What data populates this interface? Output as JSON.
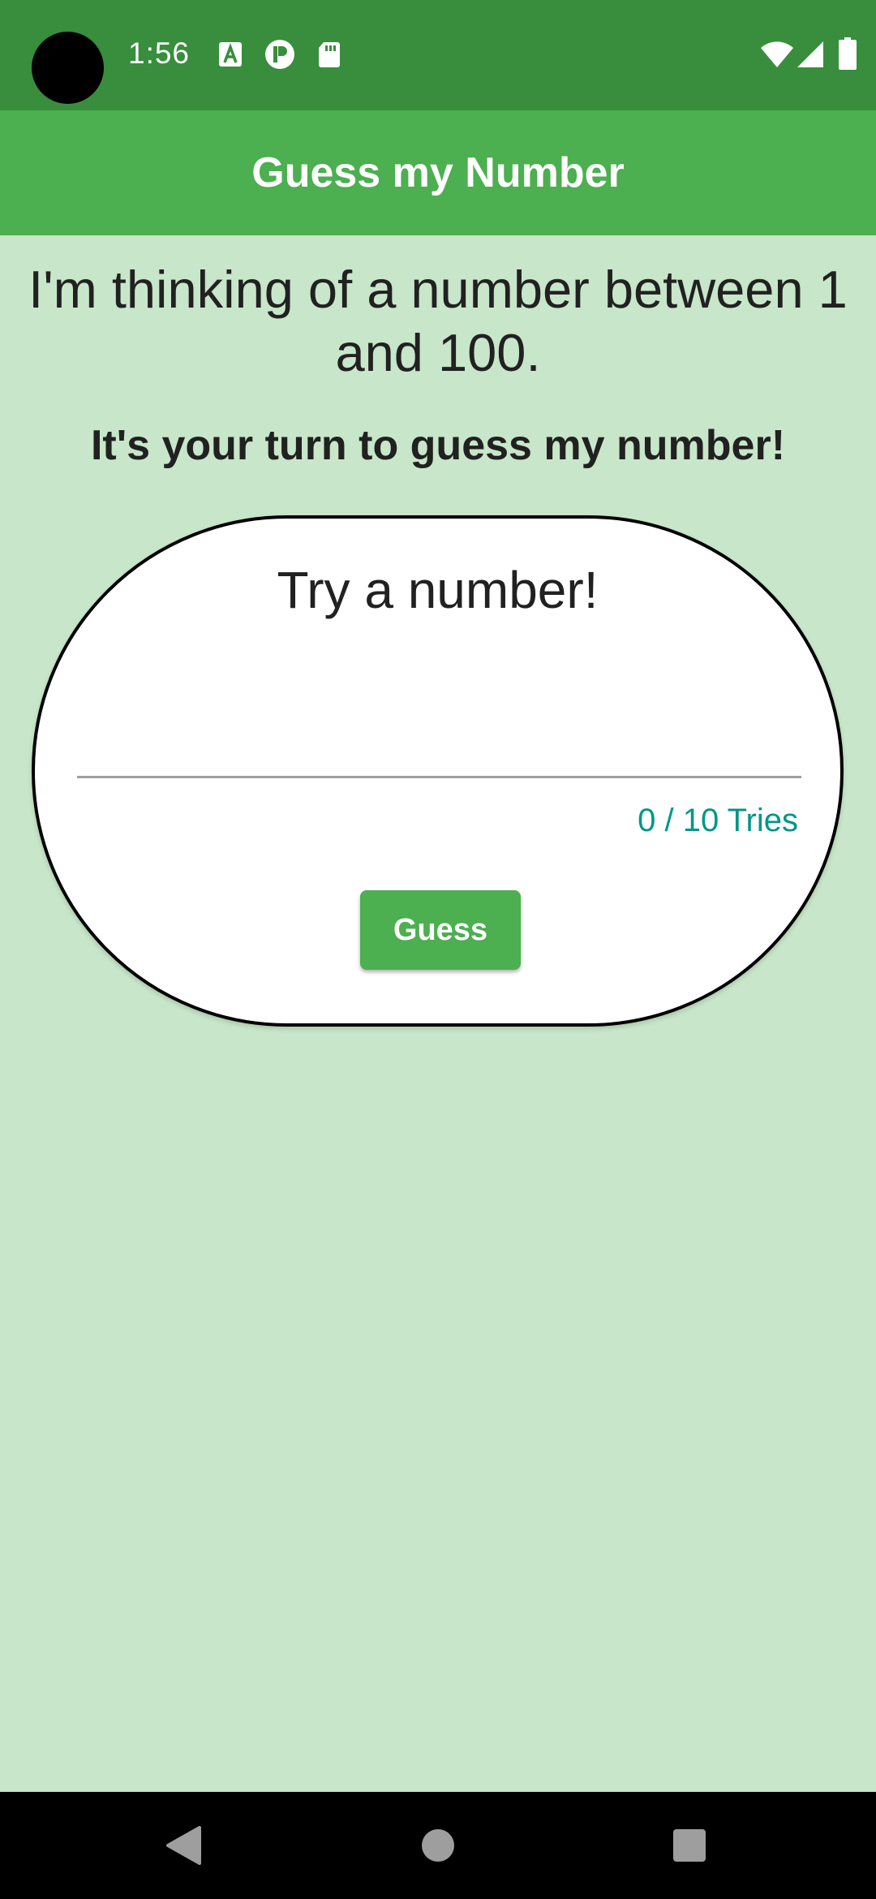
{
  "status_bar": {
    "time": "1:56",
    "icons": [
      "a-notification-icon",
      "p-notification-icon",
      "sd-card-icon",
      "wifi-icon",
      "signal-icon",
      "battery-icon"
    ]
  },
  "app_bar": {
    "title": "Guess my Number"
  },
  "main": {
    "intro": "I'm thinking of a number between 1 and 100.",
    "turn": "It's your turn to guess my number!",
    "card": {
      "prompt": "Try a number!",
      "input_value": "",
      "tries": "0 / 10 Tries",
      "button_label": "Guess"
    }
  },
  "nav_bar": {
    "icons": [
      "back-icon",
      "home-icon",
      "recents-icon"
    ]
  },
  "colors": {
    "status_bar": "#388e3c",
    "app_bar": "#4caf50",
    "background": "#c8e6c9",
    "accent_teal": "#009688"
  }
}
